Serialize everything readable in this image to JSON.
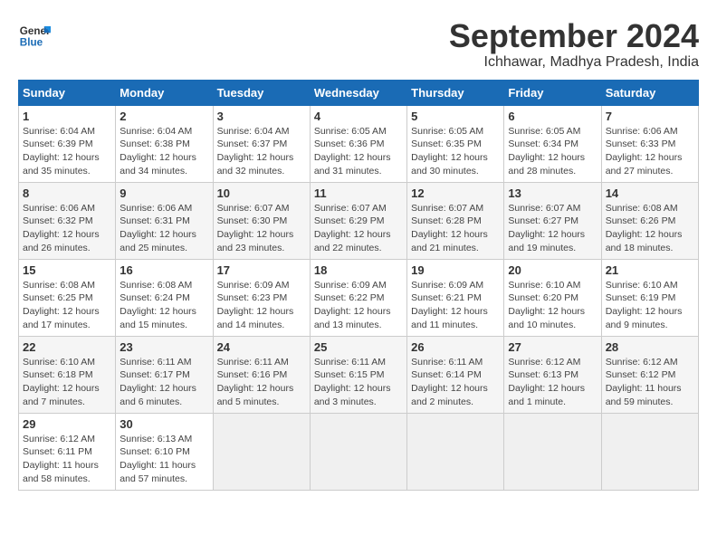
{
  "logo": {
    "text_general": "General",
    "text_blue": "Blue"
  },
  "title": "September 2024",
  "subtitle": "Ichhawar, Madhya Pradesh, India",
  "headers": [
    "Sunday",
    "Monday",
    "Tuesday",
    "Wednesday",
    "Thursday",
    "Friday",
    "Saturday"
  ],
  "weeks": [
    [
      {
        "day": "1",
        "info": "Sunrise: 6:04 AM\nSunset: 6:39 PM\nDaylight: 12 hours\nand 35 minutes."
      },
      {
        "day": "2",
        "info": "Sunrise: 6:04 AM\nSunset: 6:38 PM\nDaylight: 12 hours\nand 34 minutes."
      },
      {
        "day": "3",
        "info": "Sunrise: 6:04 AM\nSunset: 6:37 PM\nDaylight: 12 hours\nand 32 minutes."
      },
      {
        "day": "4",
        "info": "Sunrise: 6:05 AM\nSunset: 6:36 PM\nDaylight: 12 hours\nand 31 minutes."
      },
      {
        "day": "5",
        "info": "Sunrise: 6:05 AM\nSunset: 6:35 PM\nDaylight: 12 hours\nand 30 minutes."
      },
      {
        "day": "6",
        "info": "Sunrise: 6:05 AM\nSunset: 6:34 PM\nDaylight: 12 hours\nand 28 minutes."
      },
      {
        "day": "7",
        "info": "Sunrise: 6:06 AM\nSunset: 6:33 PM\nDaylight: 12 hours\nand 27 minutes."
      }
    ],
    [
      {
        "day": "8",
        "info": "Sunrise: 6:06 AM\nSunset: 6:32 PM\nDaylight: 12 hours\nand 26 minutes."
      },
      {
        "day": "9",
        "info": "Sunrise: 6:06 AM\nSunset: 6:31 PM\nDaylight: 12 hours\nand 25 minutes."
      },
      {
        "day": "10",
        "info": "Sunrise: 6:07 AM\nSunset: 6:30 PM\nDaylight: 12 hours\nand 23 minutes."
      },
      {
        "day": "11",
        "info": "Sunrise: 6:07 AM\nSunset: 6:29 PM\nDaylight: 12 hours\nand 22 minutes."
      },
      {
        "day": "12",
        "info": "Sunrise: 6:07 AM\nSunset: 6:28 PM\nDaylight: 12 hours\nand 21 minutes."
      },
      {
        "day": "13",
        "info": "Sunrise: 6:07 AM\nSunset: 6:27 PM\nDaylight: 12 hours\nand 19 minutes."
      },
      {
        "day": "14",
        "info": "Sunrise: 6:08 AM\nSunset: 6:26 PM\nDaylight: 12 hours\nand 18 minutes."
      }
    ],
    [
      {
        "day": "15",
        "info": "Sunrise: 6:08 AM\nSunset: 6:25 PM\nDaylight: 12 hours\nand 17 minutes."
      },
      {
        "day": "16",
        "info": "Sunrise: 6:08 AM\nSunset: 6:24 PM\nDaylight: 12 hours\nand 15 minutes."
      },
      {
        "day": "17",
        "info": "Sunrise: 6:09 AM\nSunset: 6:23 PM\nDaylight: 12 hours\nand 14 minutes."
      },
      {
        "day": "18",
        "info": "Sunrise: 6:09 AM\nSunset: 6:22 PM\nDaylight: 12 hours\nand 13 minutes."
      },
      {
        "day": "19",
        "info": "Sunrise: 6:09 AM\nSunset: 6:21 PM\nDaylight: 12 hours\nand 11 minutes."
      },
      {
        "day": "20",
        "info": "Sunrise: 6:10 AM\nSunset: 6:20 PM\nDaylight: 12 hours\nand 10 minutes."
      },
      {
        "day": "21",
        "info": "Sunrise: 6:10 AM\nSunset: 6:19 PM\nDaylight: 12 hours\nand 9 minutes."
      }
    ],
    [
      {
        "day": "22",
        "info": "Sunrise: 6:10 AM\nSunset: 6:18 PM\nDaylight: 12 hours\nand 7 minutes."
      },
      {
        "day": "23",
        "info": "Sunrise: 6:11 AM\nSunset: 6:17 PM\nDaylight: 12 hours\nand 6 minutes."
      },
      {
        "day": "24",
        "info": "Sunrise: 6:11 AM\nSunset: 6:16 PM\nDaylight: 12 hours\nand 5 minutes."
      },
      {
        "day": "25",
        "info": "Sunrise: 6:11 AM\nSunset: 6:15 PM\nDaylight: 12 hours\nand 3 minutes."
      },
      {
        "day": "26",
        "info": "Sunrise: 6:11 AM\nSunset: 6:14 PM\nDaylight: 12 hours\nand 2 minutes."
      },
      {
        "day": "27",
        "info": "Sunrise: 6:12 AM\nSunset: 6:13 PM\nDaylight: 12 hours\nand 1 minute."
      },
      {
        "day": "28",
        "info": "Sunrise: 6:12 AM\nSunset: 6:12 PM\nDaylight: 11 hours\nand 59 minutes."
      }
    ],
    [
      {
        "day": "29",
        "info": "Sunrise: 6:12 AM\nSunset: 6:11 PM\nDaylight: 11 hours\nand 58 minutes."
      },
      {
        "day": "30",
        "info": "Sunrise: 6:13 AM\nSunset: 6:10 PM\nDaylight: 11 hours\nand 57 minutes."
      },
      {
        "day": "",
        "info": ""
      },
      {
        "day": "",
        "info": ""
      },
      {
        "day": "",
        "info": ""
      },
      {
        "day": "",
        "info": ""
      },
      {
        "day": "",
        "info": ""
      }
    ]
  ]
}
